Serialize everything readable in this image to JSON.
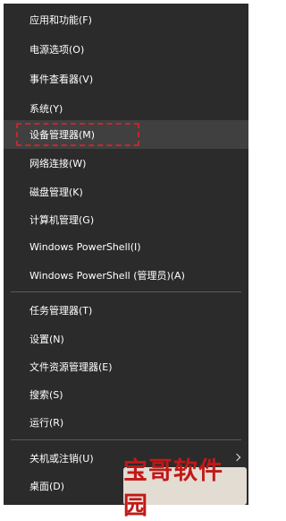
{
  "menu": {
    "items": [
      {
        "label": "应用和功能(F)"
      },
      {
        "label": "电源选项(O)"
      },
      {
        "label": "事件查看器(V)"
      },
      {
        "label": "系统(Y)"
      },
      {
        "label": "设备管理器(M)"
      },
      {
        "label": "网络连接(W)"
      },
      {
        "label": "磁盘管理(K)"
      },
      {
        "label": "计算机管理(G)"
      },
      {
        "label": "Windows PowerShell(I)"
      },
      {
        "label": "Windows PowerShell (管理员)(A)"
      },
      {
        "label": "任务管理器(T)"
      },
      {
        "label": "设置(N)"
      },
      {
        "label": "文件资源管理器(E)"
      },
      {
        "label": "搜索(S)"
      },
      {
        "label": "运行(R)"
      },
      {
        "label": "关机或注销(U)"
      },
      {
        "label": "桌面(D)"
      }
    ]
  },
  "watermark": {
    "text": "宝哥软件园"
  },
  "colors": {
    "menu_background": "#2b2b2b",
    "highlight_background": "#404040",
    "focus_outline": "#c4272f",
    "watermark_text": "#c21818"
  },
  "icons": {
    "submenu_indicator": "chevron-right-icon"
  }
}
